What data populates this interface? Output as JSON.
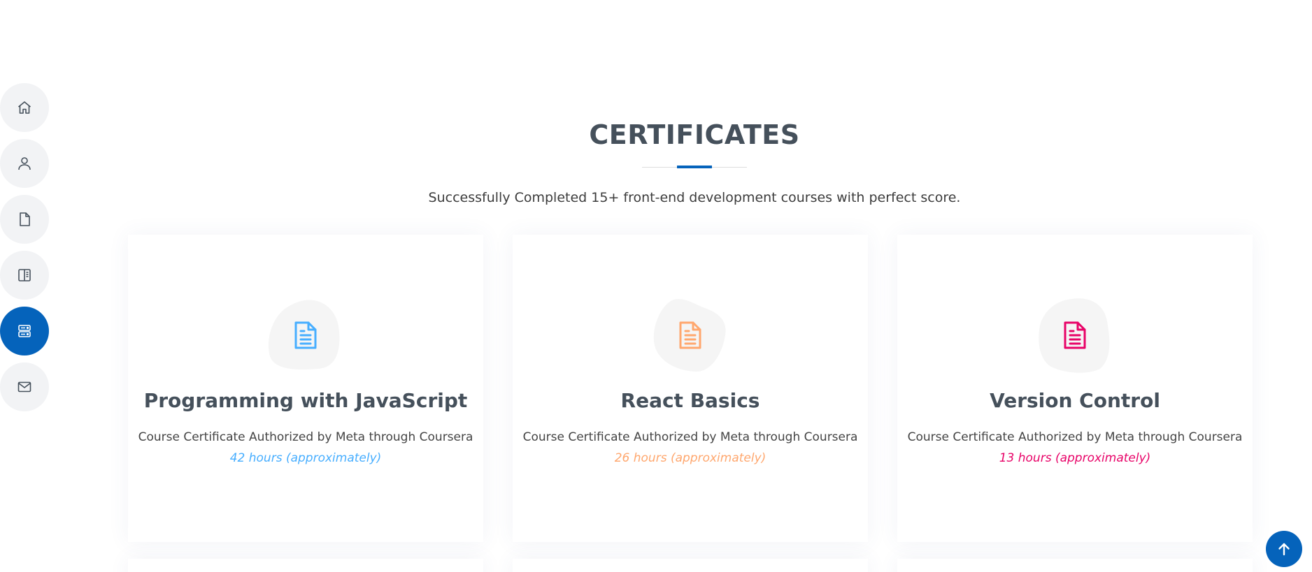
{
  "nav": {
    "items": [
      {
        "icon": "home-icon",
        "active": false
      },
      {
        "icon": "person-icon",
        "active": false
      },
      {
        "icon": "file-icon",
        "active": false
      },
      {
        "icon": "book-icon",
        "active": false
      },
      {
        "icon": "server-icon",
        "active": true
      },
      {
        "icon": "envelope-icon",
        "active": false
      }
    ],
    "active_color": "#0563bb",
    "inactive_color": "#f2f3f5"
  },
  "section": {
    "title": "CERTIFICATES",
    "subtitle": "Successfully Completed 15+ front-end development courses with perfect score."
  },
  "cards": [
    {
      "title": "Programming with JavaScript",
      "description": "Course Certificate Authorized by Meta through Coursera",
      "hours": "42 hours (approximately)",
      "color": "#47aeff",
      "icon": "document-icon"
    },
    {
      "title": "React Basics",
      "description": "Course Certificate Authorized by Meta through Coursera",
      "hours": "26 hours (approximately)",
      "color": "#ffa76e",
      "icon": "document-icon"
    },
    {
      "title": "Version Control",
      "description": "Course Certificate Authorized by Meta through Coursera",
      "hours": "13 hours (approximately)",
      "color": "#e80368",
      "icon": "document-icon"
    }
  ],
  "back_to_top": {
    "icon": "arrow-up-icon",
    "color": "#0563bb"
  }
}
